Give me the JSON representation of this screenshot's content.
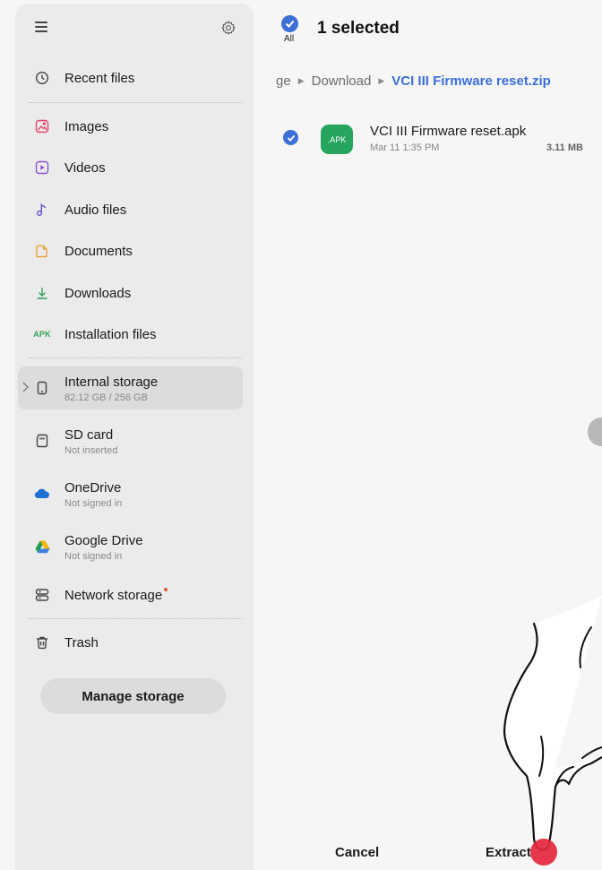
{
  "sidebar": {
    "recent": "Recent files",
    "images": "Images",
    "videos": "Videos",
    "audio": "Audio files",
    "documents": "Documents",
    "downloads": "Downloads",
    "installation_badge": "APK",
    "installation": "Installation files",
    "internal_storage": {
      "label": "Internal storage",
      "detail": "82.12 GB / 256 GB"
    },
    "sd_card": {
      "label": "SD card",
      "detail": "Not inserted"
    },
    "onedrive": {
      "label": "OneDrive",
      "detail": "Not signed in"
    },
    "google_drive": {
      "label": "Google Drive",
      "detail": "Not signed in"
    },
    "network": "Network storage",
    "trash": "Trash",
    "manage_storage": "Manage storage"
  },
  "header": {
    "all_label": "All",
    "title": "1 selected"
  },
  "breadcrumb": {
    "parts": [
      "ge",
      "Download"
    ],
    "current": "VCI III Firmware reset.zip"
  },
  "files": [
    {
      "icon_text": ".APK",
      "name": "VCI III Firmware reset.apk",
      "date": "Mar 11 1:35 PM",
      "size": "3.11 MB",
      "selected": true
    }
  ],
  "footer": {
    "cancel": "Cancel",
    "extract": "Extract"
  },
  "colors": {
    "accent": "#3d6fd7",
    "apk_green": "#25a560",
    "tap_indicator": "#e5263b"
  }
}
